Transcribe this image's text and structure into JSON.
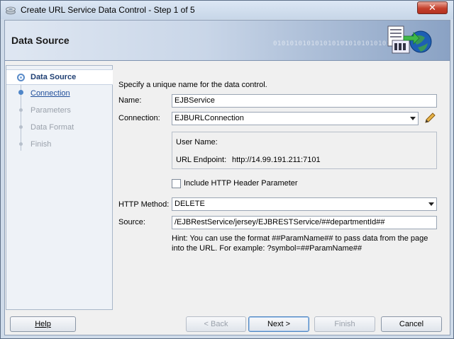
{
  "window": {
    "title": "Create URL Service Data Control  - Step 1 of 5",
    "close_glyph": "✕"
  },
  "banner": {
    "title": "Data Source",
    "binary_text": "01010101010101010101010101010"
  },
  "steps": [
    {
      "label": "Data Source",
      "state": "current"
    },
    {
      "label": "Connection",
      "state": "link"
    },
    {
      "label": "Parameters",
      "state": "disabled"
    },
    {
      "label": "Data Format",
      "state": "disabled"
    },
    {
      "label": "Finish",
      "state": "disabled"
    }
  ],
  "form": {
    "instruction": "Specify a unique name for the data control.",
    "name_label": "Name:",
    "name_value": "EJBService",
    "connection_label": "Connection:",
    "connection_value": "EJBURLConnection",
    "user_name_label": "User Name:",
    "url_endpoint_label": "URL Endpoint:",
    "url_endpoint_value": "http://14.99.191.211:7101",
    "include_header_label": "Include HTTP Header Parameter",
    "include_header_checked": false,
    "http_method_label": "HTTP Method:",
    "http_method_value": "DELETE",
    "source_label": "Source:",
    "source_value": "/EJBRestService/jersey/EJBRESTService/##departmentId##",
    "hint_line1": "Hint: You can use the format ##ParamName## to pass data from the page",
    "hint_line2": "into the URL. For example: ?symbol=##ParamName##"
  },
  "buttons": {
    "help": "Help",
    "back": "< Back",
    "next": "Next >",
    "finish": "Finish",
    "cancel": "Cancel"
  },
  "colors": {
    "link": "#1f4e9a",
    "disabled_text": "#9aa1ab",
    "edit_icon": "#d89a1c"
  }
}
